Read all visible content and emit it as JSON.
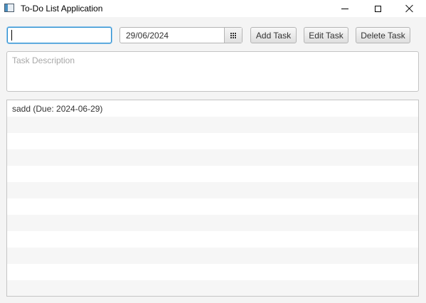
{
  "window": {
    "title": "To-Do List Application"
  },
  "toolbar": {
    "task_input_value": "",
    "due_date": "29/06/2024",
    "add_label": "Add Task",
    "edit_label": "Edit Task",
    "delete_label": "Delete Task"
  },
  "description": {
    "placeholder": "Task Description",
    "value": ""
  },
  "task_list": {
    "items": [
      "sadd (Due: 2024-06-29)"
    ],
    "empty_rows": 11
  },
  "icons": {
    "app": "app-window-icon",
    "minimize": "minimize-icon",
    "maximize": "maximize-icon",
    "close": "close-icon",
    "calendar": "calendar-icon"
  }
}
